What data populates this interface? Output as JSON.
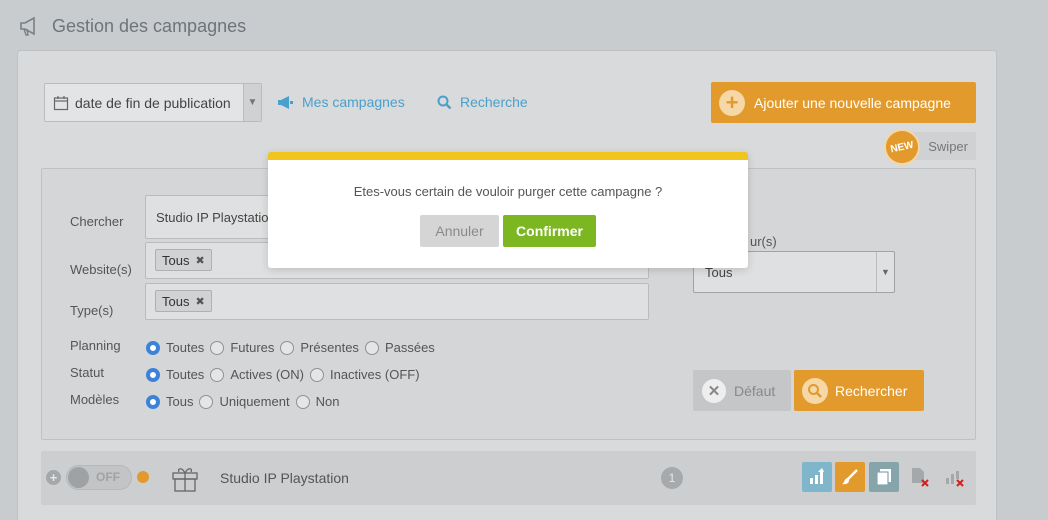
{
  "header": {
    "title": "Gestion des campagnes"
  },
  "toolbar": {
    "sort_value": "date de fin de publication",
    "my_campaigns_label": "Mes campagnes",
    "search_label": "Recherche",
    "add_campaign_label": "Ajouter une nouvelle campagne",
    "new_badge": "NEW",
    "swiper_label": "Swiper"
  },
  "filters": {
    "search_label": "Chercher",
    "search_value": "Studio IP Playstation",
    "website_label": "Website(s)",
    "website_tag": "Tous",
    "type_label": "Type(s)",
    "type_tag": "Tous",
    "user_label_partial": "ur(s)",
    "user_value": "Tous",
    "planning": {
      "label": "Planning",
      "options": [
        "Toutes",
        "Futures",
        "Présentes",
        "Passées"
      ],
      "selected": 0
    },
    "statut": {
      "label": "Statut",
      "options": [
        "Toutes",
        "Actives (ON)",
        "Inactives (OFF)"
      ],
      "selected": 0
    },
    "modeles": {
      "label": "Modèles",
      "options": [
        "Tous",
        "Uniquement",
        "Non"
      ],
      "selected": 0
    },
    "default_button": "Défaut",
    "search_button": "Rechercher"
  },
  "campaign": {
    "toggle_state": "OFF",
    "name": "Studio IP Playstation",
    "count": "1"
  },
  "modal": {
    "message": "Etes-vous certain de vouloir purger cette campagne ?",
    "cancel_label": "Annuler",
    "confirm_label": "Confirmer"
  },
  "colors": {
    "accent_orange": "#e39a2c",
    "confirm_green": "#7cb721",
    "modal_top_bar": "#f2c51e",
    "link_blue": "#4aa0cc"
  }
}
